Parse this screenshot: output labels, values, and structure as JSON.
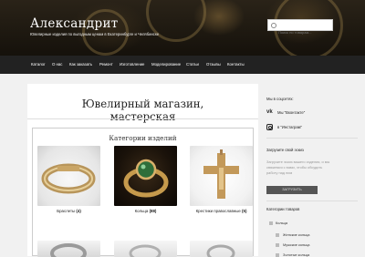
{
  "site": {
    "title": "Александрит",
    "description": "Ювелирные изделия по выгодным ценам в Екатеринбурге и Челябинске"
  },
  "search": {
    "placeholder": "Поиск по товарам..."
  },
  "nav": {
    "items": [
      {
        "label": "Каталог"
      },
      {
        "label": "О нас"
      },
      {
        "label": "Как заказать"
      },
      {
        "label": "Ремонт"
      },
      {
        "label": "Изготовление"
      },
      {
        "label": "Моделирование"
      },
      {
        "label": "Статьи"
      },
      {
        "label": "Отзывы"
      },
      {
        "label": "Контакты"
      }
    ]
  },
  "main": {
    "page_title": "Ювелирный магазин, мастерская",
    "categories_title": "Категории изделий",
    "products": [
      {
        "name": "Браслеты",
        "count": "(4)"
      },
      {
        "name": "Кольца",
        "count": "(88)"
      },
      {
        "name": "Крестики православные",
        "count": "(5)"
      }
    ]
  },
  "sidebar": {
    "social_title": "Мы в соцсетях:",
    "social_links": [
      {
        "label": "Мы \"Вконтакте\"",
        "icon": "vk-icon"
      },
      {
        "label": "в \"Инстаграм\"",
        "icon": "instagram-icon"
      }
    ],
    "upload_title": "Загрузите свой эскиз",
    "upload_text": "Загрузите эскиз вашего изделия, и мы свяжемся с вами, чтобы обсудить работу над ним",
    "upload_button": "ЗАГРУЗИТЬ",
    "cat_title": "Категории товаров",
    "categories": [
      {
        "label": "Кольца",
        "level": 0
      },
      {
        "label": "Женские кольца",
        "level": 1
      },
      {
        "label": "Мужские кольца",
        "level": 1
      },
      {
        "label": "Золотые кольца",
        "level": 1
      }
    ]
  }
}
